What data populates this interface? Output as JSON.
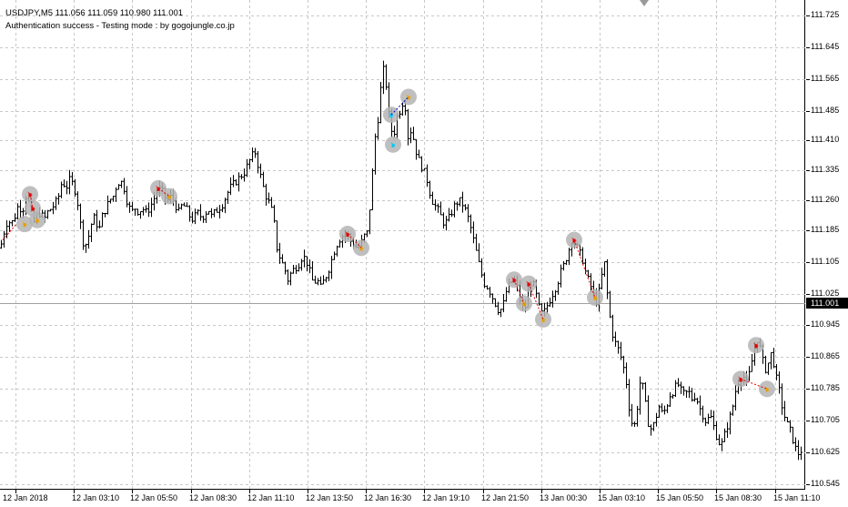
{
  "header": {
    "symbol_line": "USDJPY,M5  111.056 111.059 110.980 111.001",
    "status_line": "Authentication success - Testing mode : by gogojungle.co.jp"
  },
  "price_axis": {
    "labels": [
      "111.725",
      "111.645",
      "111.565",
      "111.485",
      "111.410",
      "111.335",
      "111.260",
      "111.185",
      "111.105",
      "111.025",
      "110.945",
      "110.865",
      "110.785",
      "110.705",
      "110.625",
      "110.545"
    ],
    "current_price": "111.001"
  },
  "time_axis": {
    "labels": [
      "12 Jan 2018",
      "12 Jan 03:10",
      "12 Jan 05:50",
      "12 Jan 08:30",
      "12 Jan 11:10",
      "12 Jan 13:50",
      "12 Jan 16:30",
      "12 Jan 19:10",
      "12 Jan 21:50",
      "13 Jan 00:30",
      "15 Jan 03:10",
      "15 Jan 05:50",
      "15 Jan 08:30",
      "15 Jan 11:10"
    ]
  },
  "colors": {
    "grid": "#c8c8c8",
    "bars": "#000000",
    "marker_circle": "#b4b4b4",
    "sell_arrow": "#e00000",
    "buy_arrow": "#00c8ff",
    "close_arrow": "#e8a000"
  },
  "chart_data": {
    "type": "bar",
    "symbol": "USDJPY",
    "timeframe": "M5",
    "ylim": [
      110.545,
      111.725
    ],
    "close_path": [
      [
        0,
        111.14
      ],
      [
        4,
        111.18
      ],
      [
        8,
        111.21
      ],
      [
        12,
        111.2
      ],
      [
        16,
        111.22
      ],
      [
        20,
        111.25
      ],
      [
        24,
        111.23
      ],
      [
        28,
        111.27
      ],
      [
        32,
        111.25
      ],
      [
        36,
        111.2
      ],
      [
        40,
        111.22
      ],
      [
        44,
        111.23
      ],
      [
        48,
        111.21
      ],
      [
        52,
        111.23
      ],
      [
        56,
        111.24
      ],
      [
        60,
        111.25
      ],
      [
        64,
        111.27
      ],
      [
        68,
        111.31
      ],
      [
        72,
        111.29
      ],
      [
        76,
        111.31
      ],
      [
        80,
        111.3
      ],
      [
        84,
        111.27
      ],
      [
        88,
        111.2
      ],
      [
        92,
        111.14
      ],
      [
        96,
        111.16
      ],
      [
        100,
        111.2
      ],
      [
        104,
        111.22
      ],
      [
        108,
        111.18
      ],
      [
        112,
        111.22
      ],
      [
        116,
        111.24
      ],
      [
        120,
        111.26
      ],
      [
        124,
        111.27
      ],
      [
        128,
        111.3
      ],
      [
        132,
        111.31
      ],
      [
        136,
        111.29
      ],
      [
        140,
        111.25
      ],
      [
        144,
        111.23
      ],
      [
        148,
        111.24
      ],
      [
        152,
        111.23
      ],
      [
        156,
        111.24
      ],
      [
        160,
        111.23
      ],
      [
        164,
        111.24
      ],
      [
        168,
        111.26
      ],
      [
        172,
        111.28
      ],
      [
        176,
        111.29
      ],
      [
        180,
        111.27
      ],
      [
        184,
        111.26
      ],
      [
        188,
        111.27
      ],
      [
        192,
        111.25
      ],
      [
        196,
        111.23
      ],
      [
        200,
        111.25
      ],
      [
        204,
        111.24
      ],
      [
        208,
        111.22
      ],
      [
        212,
        111.21
      ],
      [
        216,
        111.23
      ],
      [
        220,
        111.22
      ],
      [
        224,
        111.22
      ],
      [
        228,
        111.24
      ],
      [
        232,
        111.22
      ],
      [
        236,
        111.23
      ],
      [
        240,
        111.24
      ],
      [
        244,
        111.25
      ],
      [
        248,
        111.27
      ],
      [
        252,
        111.29
      ],
      [
        256,
        111.3
      ],
      [
        260,
        111.31
      ],
      [
        264,
        111.32
      ],
      [
        268,
        111.33
      ],
      [
        272,
        111.35
      ],
      [
        276,
        111.37
      ],
      [
        280,
        111.38
      ],
      [
        284,
        111.34
      ],
      [
        288,
        111.3
      ],
      [
        292,
        111.27
      ],
      [
        296,
        111.25
      ],
      [
        300,
        111.22
      ],
      [
        304,
        111.14
      ],
      [
        308,
        111.11
      ],
      [
        312,
        111.09
      ],
      [
        316,
        111.06
      ],
      [
        320,
        111.08
      ],
      [
        324,
        111.09
      ],
      [
        328,
        111.1
      ],
      [
        332,
        111.12
      ],
      [
        336,
        111.11
      ],
      [
        340,
        111.08
      ],
      [
        344,
        111.05
      ],
      [
        348,
        111.06
      ],
      [
        352,
        111.04
      ],
      [
        356,
        111.06
      ],
      [
        360,
        111.08
      ],
      [
        364,
        111.11
      ],
      [
        368,
        111.14
      ],
      [
        372,
        111.16
      ],
      [
        376,
        111.17
      ],
      [
        380,
        111.18
      ],
      [
        384,
        111.16
      ],
      [
        388,
        111.15
      ],
      [
        392,
        111.14
      ],
      [
        396,
        111.15
      ],
      [
        400,
        111.17
      ],
      [
        404,
        111.18
      ],
      [
        408,
        111.3
      ],
      [
        412,
        111.42
      ],
      [
        416,
        111.48
      ],
      [
        420,
        111.6
      ],
      [
        424,
        111.55
      ],
      [
        428,
        111.45
      ],
      [
        432,
        111.42
      ],
      [
        436,
        111.47
      ],
      [
        440,
        111.49
      ],
      [
        444,
        111.52
      ],
      [
        448,
        111.42
      ],
      [
        452,
        111.44
      ],
      [
        456,
        111.39
      ],
      [
        460,
        111.36
      ],
      [
        464,
        111.34
      ],
      [
        468,
        111.32
      ],
      [
        472,
        111.28
      ],
      [
        476,
        111.25
      ],
      [
        480,
        111.24
      ],
      [
        484,
        111.22
      ],
      [
        488,
        111.2
      ],
      [
        492,
        111.21
      ],
      [
        496,
        111.23
      ],
      [
        500,
        111.25
      ],
      [
        504,
        111.26
      ],
      [
        508,
        111.25
      ],
      [
        512,
        111.23
      ],
      [
        516,
        111.2
      ],
      [
        520,
        111.16
      ],
      [
        524,
        111.12
      ],
      [
        528,
        111.08
      ],
      [
        532,
        111.05
      ],
      [
        536,
        111.04
      ],
      [
        540,
        111.02
      ],
      [
        544,
        111.0
      ],
      [
        548,
        110.98
      ],
      [
        552,
        110.99
      ],
      [
        556,
        111.03
      ],
      [
        560,
        111.05
      ],
      [
        564,
        111.06
      ],
      [
        568,
        111.04
      ],
      [
        572,
        111.0
      ],
      [
        576,
        110.98
      ],
      [
        580,
        111.03
      ],
      [
        584,
        111.06
      ],
      [
        588,
        111.03
      ],
      [
        592,
        110.99
      ],
      [
        596,
        110.97
      ],
      [
        600,
        110.99
      ],
      [
        604,
        111.01
      ],
      [
        608,
        111.03
      ],
      [
        612,
        111.05
      ],
      [
        616,
        111.08
      ],
      [
        620,
        111.1
      ],
      [
        624,
        111.13
      ],
      [
        628,
        111.16
      ],
      [
        632,
        111.15
      ],
      [
        636,
        111.13
      ],
      [
        640,
        111.11
      ],
      [
        644,
        111.07
      ],
      [
        648,
        111.05
      ],
      [
        652,
        111.02
      ],
      [
        656,
        111.0
      ],
      [
        660,
        111.06
      ],
      [
        664,
        111.1
      ],
      [
        668,
        111.0
      ],
      [
        672,
        110.93
      ],
      [
        676,
        110.9
      ],
      [
        680,
        110.88
      ],
      [
        684,
        110.85
      ],
      [
        688,
        110.8
      ],
      [
        692,
        110.72
      ],
      [
        696,
        110.68
      ],
      [
        700,
        110.74
      ],
      [
        704,
        110.82
      ],
      [
        708,
        110.76
      ],
      [
        712,
        110.7
      ],
      [
        716,
        110.68
      ],
      [
        720,
        110.71
      ],
      [
        724,
        110.74
      ],
      [
        728,
        110.72
      ],
      [
        732,
        110.74
      ],
      [
        736,
        110.77
      ],
      [
        740,
        110.78
      ],
      [
        744,
        110.8
      ],
      [
        748,
        110.78
      ],
      [
        752,
        110.77
      ],
      [
        756,
        110.78
      ],
      [
        760,
        110.76
      ],
      [
        764,
        110.77
      ],
      [
        768,
        110.74
      ],
      [
        772,
        110.72
      ],
      [
        776,
        110.7
      ],
      [
        780,
        110.72
      ],
      [
        784,
        110.69
      ],
      [
        788,
        110.66
      ],
      [
        792,
        110.64
      ],
      [
        796,
        110.67
      ],
      [
        800,
        110.7
      ],
      [
        804,
        110.73
      ],
      [
        808,
        110.78
      ],
      [
        812,
        110.81
      ],
      [
        816,
        110.82
      ],
      [
        820,
        110.8
      ],
      [
        824,
        110.83
      ],
      [
        828,
        110.88
      ],
      [
        832,
        110.91
      ],
      [
        836,
        110.88
      ],
      [
        840,
        110.83
      ],
      [
        844,
        110.85
      ],
      [
        848,
        110.88
      ],
      [
        852,
        110.82
      ],
      [
        856,
        110.78
      ],
      [
        860,
        110.73
      ],
      [
        864,
        110.7
      ],
      [
        868,
        110.68
      ],
      [
        872,
        110.65
      ],
      [
        876,
        110.62
      ],
      [
        880,
        110.63
      ],
      [
        884,
        110.6
      ]
    ],
    "trade_markers": [
      {
        "bar_index": 33,
        "price": 111.275,
        "type": "sell"
      },
      {
        "bar_index": 36,
        "price": 111.24,
        "type": "sell"
      },
      {
        "bar_index": 27,
        "price": 111.2,
        "type": "close"
      },
      {
        "bar_index": 41,
        "price": 111.21,
        "type": "close"
      },
      {
        "bar_index": 174,
        "price": 111.29,
        "type": "sell"
      },
      {
        "bar_index": 186,
        "price": 111.27,
        "type": "close"
      },
      {
        "bar_index": 382,
        "price": 111.175,
        "type": "sell"
      },
      {
        "bar_index": 397,
        "price": 111.14,
        "type": "close"
      },
      {
        "bar_index": 430,
        "price": 111.475,
        "type": "buy"
      },
      {
        "bar_index": 432,
        "price": 111.4,
        "type": "buy"
      },
      {
        "bar_index": 449,
        "price": 111.52,
        "type": "close"
      },
      {
        "bar_index": 565,
        "price": 111.06,
        "type": "sell"
      },
      {
        "bar_index": 581,
        "price": 111.05,
        "type": "sell"
      },
      {
        "bar_index": 576,
        "price": 111.0,
        "type": "close"
      },
      {
        "bar_index": 597,
        "price": 110.96,
        "type": "close"
      },
      {
        "bar_index": 631,
        "price": 111.16,
        "type": "sell"
      },
      {
        "bar_index": 654,
        "price": 111.015,
        "type": "close"
      },
      {
        "bar_index": 814,
        "price": 110.81,
        "type": "sell"
      },
      {
        "bar_index": 831,
        "price": 110.895,
        "type": "sell"
      },
      {
        "bar_index": 843,
        "price": 110.785,
        "type": "close"
      }
    ]
  }
}
